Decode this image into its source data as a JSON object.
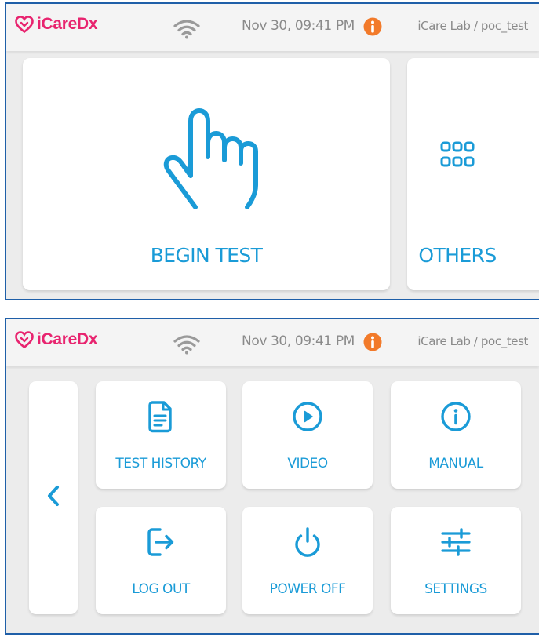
{
  "screens": [
    {
      "header": {
        "logo_text": "iCareDx",
        "datetime": "Nov 30, 09:41 PM",
        "lab": "iCare Lab / poc_test"
      },
      "begin_test_label": "BEGIN TEST",
      "others_label": "OTHERS"
    },
    {
      "header": {
        "logo_text": "iCareDx",
        "datetime": "Nov 30, 09:41 PM",
        "lab": "iCare Lab / poc_test"
      },
      "tiles": [
        {
          "label": "TEST HISTORY",
          "icon": "document-icon"
        },
        {
          "label": "VIDEO",
          "icon": "play-icon"
        },
        {
          "label": "MANUAL",
          "icon": "info-icon"
        },
        {
          "label": "LOG OUT",
          "icon": "logout-icon"
        },
        {
          "label": "POWER OFF",
          "icon": "power-icon"
        },
        {
          "label": "SETTINGS",
          "icon": "sliders-icon"
        }
      ]
    }
  ],
  "colors": {
    "accent": "#1a9bd7",
    "brand": "#e8246f",
    "info_badge": "#f27a2a",
    "background": "#ececec",
    "border": "#1f5fa8"
  }
}
